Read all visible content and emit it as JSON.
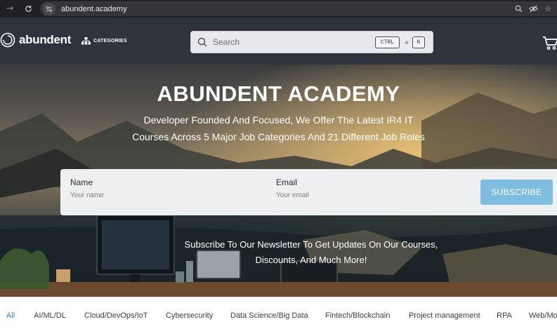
{
  "browser": {
    "url": "abundent.academy",
    "nav_icons": [
      "back-arrow-icon",
      "reload-icon",
      "site-info-icon"
    ],
    "action_icons": [
      "zoom-icon",
      "eye-slash-icon",
      "bookmark-star-icon"
    ]
  },
  "header": {
    "logo_text": "abundent",
    "categories_label": "CATEGORIES",
    "search": {
      "placeholder": "Search",
      "shortcut_ctrl": "CTRL",
      "shortcut_plus": "+",
      "shortcut_key": "K"
    }
  },
  "hero": {
    "title": "ABUNDENT ACADEMY",
    "subtitle_line1": "Developer Founded And Focused, We Offer The Latest IR4 IT",
    "subtitle_line2": "Courses Across 5 Major Job Categories And 21 Different Job Roles",
    "form": {
      "name_label": "Name",
      "name_placeholder": "Your name",
      "email_label": "Email",
      "email_placeholder": "Your email",
      "subscribe_label": "SUBSCRIBE"
    },
    "newsletter_line1": "Subscribe To Our Newsletter To Get Updates On Our Courses,",
    "newsletter_line2": "Discounts, And Much More!"
  },
  "tabs": [
    {
      "label": "All",
      "active": true
    },
    {
      "label": "AI/ML/DL",
      "active": false
    },
    {
      "label": "Cloud/DevOps/IoT",
      "active": false
    },
    {
      "label": "Cybersecurity",
      "active": false
    },
    {
      "label": "Data Science/Big Data",
      "active": false
    },
    {
      "label": "Fintech/Blockchain",
      "active": false
    },
    {
      "label": "Project management",
      "active": false
    },
    {
      "label": "RPA",
      "active": false
    },
    {
      "label": "Web/Mo",
      "active": false
    }
  ],
  "colors": {
    "accent": "#2f7fd0",
    "subscribe_button": "#7ebde0",
    "header_bg": "#2f343c"
  }
}
